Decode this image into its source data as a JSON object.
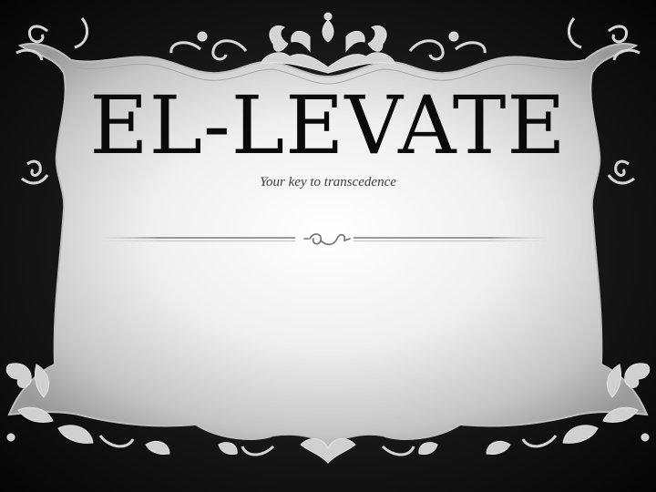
{
  "slide": {
    "title": "EL-LEVATE",
    "subtitle": "Your key to transcedence"
  },
  "icons": {
    "top_ornament": "baroque-scroll-icon",
    "corner_ornaments": "filigree-corner-icon",
    "divider_ornament": "flourish-swirl-icon"
  },
  "colors": {
    "background": "#0d0d0d",
    "panel_light": "#ffffff",
    "panel_shadow": "#8e8e8e",
    "title": "#0a0a0a",
    "subtitle": "#3b3b3b",
    "ornament": "#d8d8d8"
  }
}
